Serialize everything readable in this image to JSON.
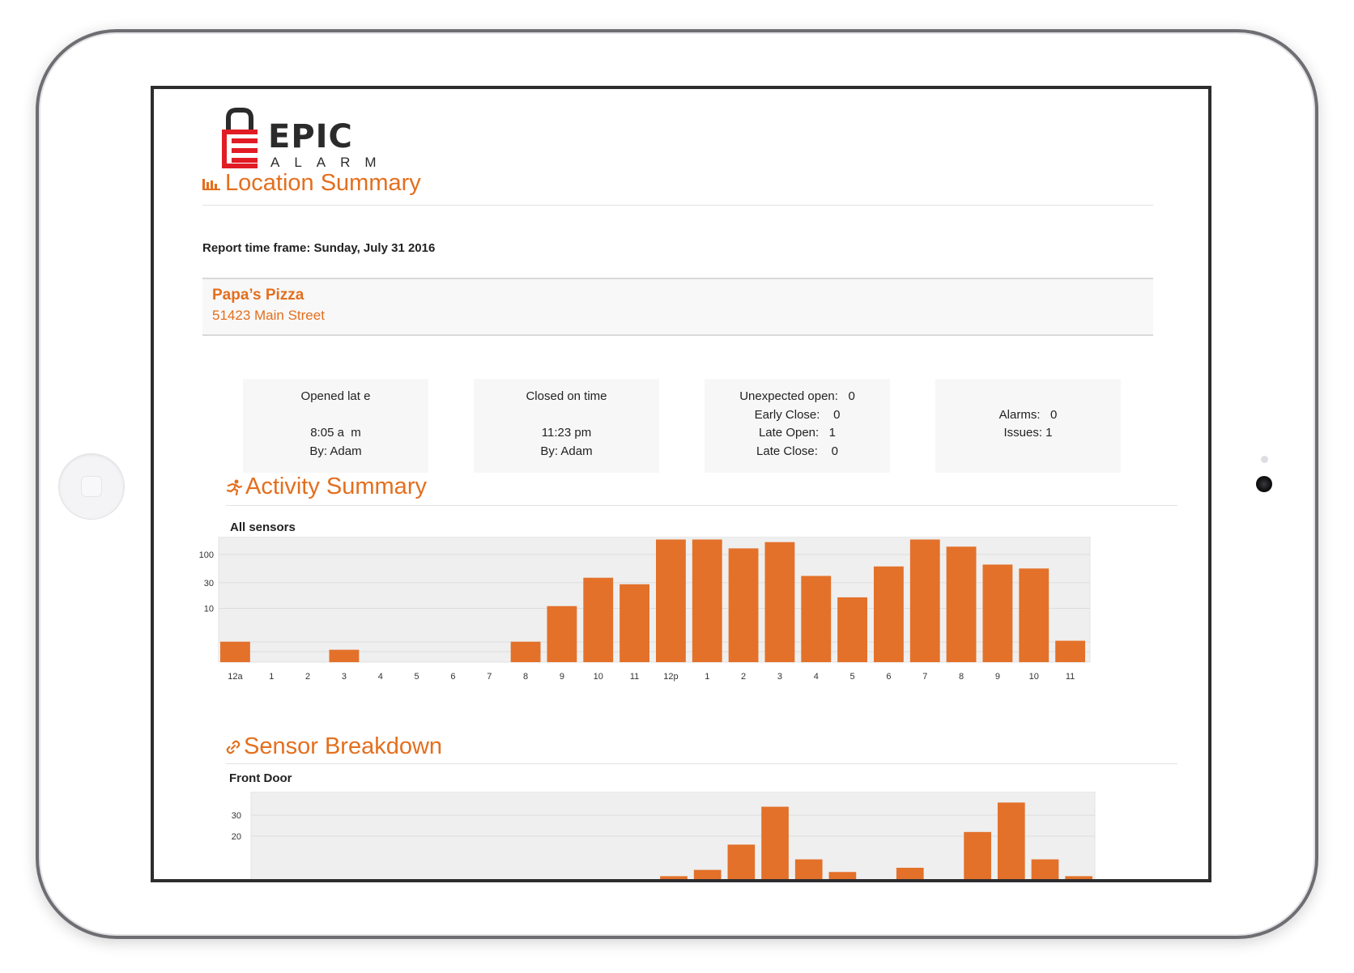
{
  "logo": {
    "word": "EPIC",
    "sub": "ALARM"
  },
  "location_summary": {
    "title": "Location Summary",
    "timeframe": "Report time frame: Sunday, July 31 2016",
    "location_name": "Papa’s Pizza",
    "location_address": "51423 Main Street"
  },
  "stats": [
    {
      "lines": [
        "Opened lat e",
        "",
        "8:05 a  m",
        "By: Adam"
      ]
    },
    {
      "lines": [
        "Closed on time",
        "",
        "11:23 pm",
        "By: Adam"
      ]
    },
    {
      "lines": [
        "Unexpected open:   0",
        "Early Close:    0",
        "Late Open:   1",
        "Late Close:    0"
      ]
    },
    {
      "lines": [
        "",
        "Alarms:   0",
        "Issues: 1",
        ""
      ]
    }
  ],
  "activity_summary": {
    "title": "Activity Summary",
    "chart_label": "All sensors"
  },
  "sensor_breakdown": {
    "title": "Sensor Breakdown",
    "chart_label": "Front Door"
  },
  "colors": {
    "accent": "#e36f1e",
    "bar": "#e3712a",
    "brand_red": "#e11c24"
  },
  "icons": {
    "location_summary": "bar-chart-icon",
    "activity_summary": "running-person-icon",
    "sensor_breakdown": "link-icon"
  },
  "chart_data": [
    {
      "type": "bar",
      "title": "All sensors",
      "categories": [
        "12a",
        "1",
        "2",
        "3",
        "4",
        "5",
        "6",
        "7",
        "8",
        "9",
        "10",
        "11",
        "12p",
        "1",
        "2",
        "3",
        "4",
        "5",
        "6",
        "7",
        "8",
        "9",
        "10",
        "11"
      ],
      "values": [
        2.4,
        1.0,
        1.0,
        1.7,
        1.0,
        1.0,
        1.0,
        1.0,
        2.4,
        11,
        37,
        28,
        190,
        190,
        130,
        170,
        40,
        16,
        60,
        190,
        140,
        65,
        55,
        2.5
      ],
      "yscale": "log",
      "yticks": [
        10,
        30,
        100
      ],
      "grid": true,
      "legend": "none"
    },
    {
      "type": "bar",
      "title": "Front Door",
      "categories": [
        "12a",
        "1",
        "2",
        "3",
        "4",
        "5",
        "6",
        "7",
        "8",
        "9",
        "10",
        "11",
        "12p",
        "1",
        "2",
        "3",
        "4",
        "5",
        "6",
        "7",
        "8",
        "9",
        "10",
        "11"
      ],
      "values": [
        0,
        0,
        0,
        0,
        0,
        0,
        0,
        0,
        0,
        0,
        0,
        0,
        1,
        4,
        16,
        34,
        9,
        3,
        0,
        5,
        0,
        22,
        36,
        9,
        1
      ],
      "yticks": [
        20,
        30
      ],
      "grid": true,
      "legend": "none",
      "note": "chart is cropped at the bottom edge of the screen"
    }
  ]
}
